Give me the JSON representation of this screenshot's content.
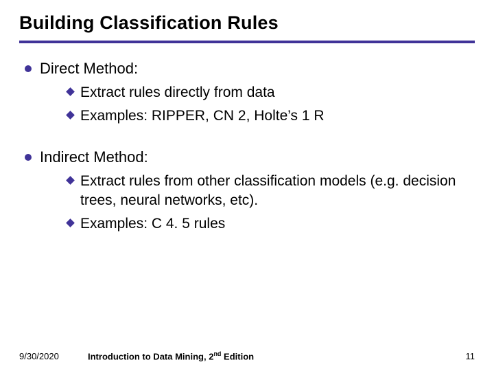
{
  "title": "Building Classification Rules",
  "sections": {
    "direct": {
      "heading": "Direct Method:",
      "items": {
        "a": "Extract rules directly from data",
        "b": "Examples: RIPPER, CN 2, Holte’s 1 R"
      }
    },
    "indirect": {
      "heading": "Indirect Method:",
      "items": {
        "a": "Extract rules from other classification models (e.g. decision trees, neural networks, etc).",
        "b": "Examples: C 4. 5 rules"
      }
    }
  },
  "footer": {
    "date": "9/30/2020",
    "book_prefix": "Introduction to Data Mining, 2",
    "book_sup": "nd",
    "book_suffix": " Edition",
    "page": "11"
  }
}
